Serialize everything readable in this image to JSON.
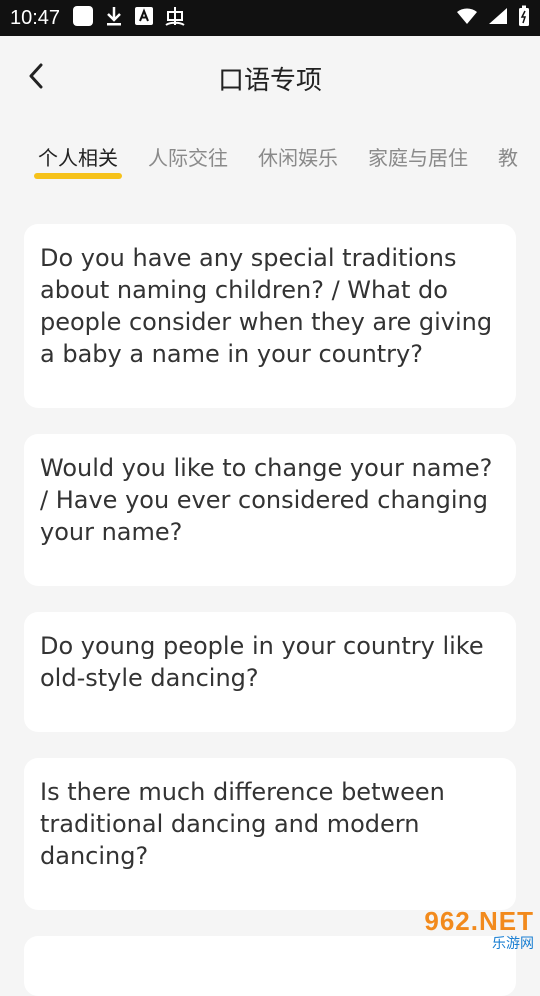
{
  "status_bar": {
    "time": "10:47",
    "left_icons": [
      "app-square-icon",
      "download-icon",
      "font-a-icon",
      "bug-icon"
    ],
    "right_icons": [
      "wifi-icon",
      "signal-icon",
      "battery-icon"
    ]
  },
  "header": {
    "title": "口语专项",
    "back_icon": "chevron-left-icon"
  },
  "tabs": [
    {
      "label": "个人相关",
      "active": true
    },
    {
      "label": "人际交往",
      "active": false
    },
    {
      "label": "休闲娱乐",
      "active": false
    },
    {
      "label": "家庭与居住",
      "active": false
    },
    {
      "label": "教",
      "active": false
    }
  ],
  "accent_color": "#f6c21a",
  "questions": [
    {
      "text": "Do you have any special traditions about naming children? / What do people consider when they are giving a baby a name in your country?"
    },
    {
      "text": "Would you like to change your name? / Have you ever considered changing your name?"
    },
    {
      "text": "Do young people in your country like old-style dancing?"
    },
    {
      "text": "Is there much difference between traditional dancing and modern dancing?"
    }
  ],
  "watermark": {
    "number": "962.NET",
    "sub": "乐游网"
  }
}
